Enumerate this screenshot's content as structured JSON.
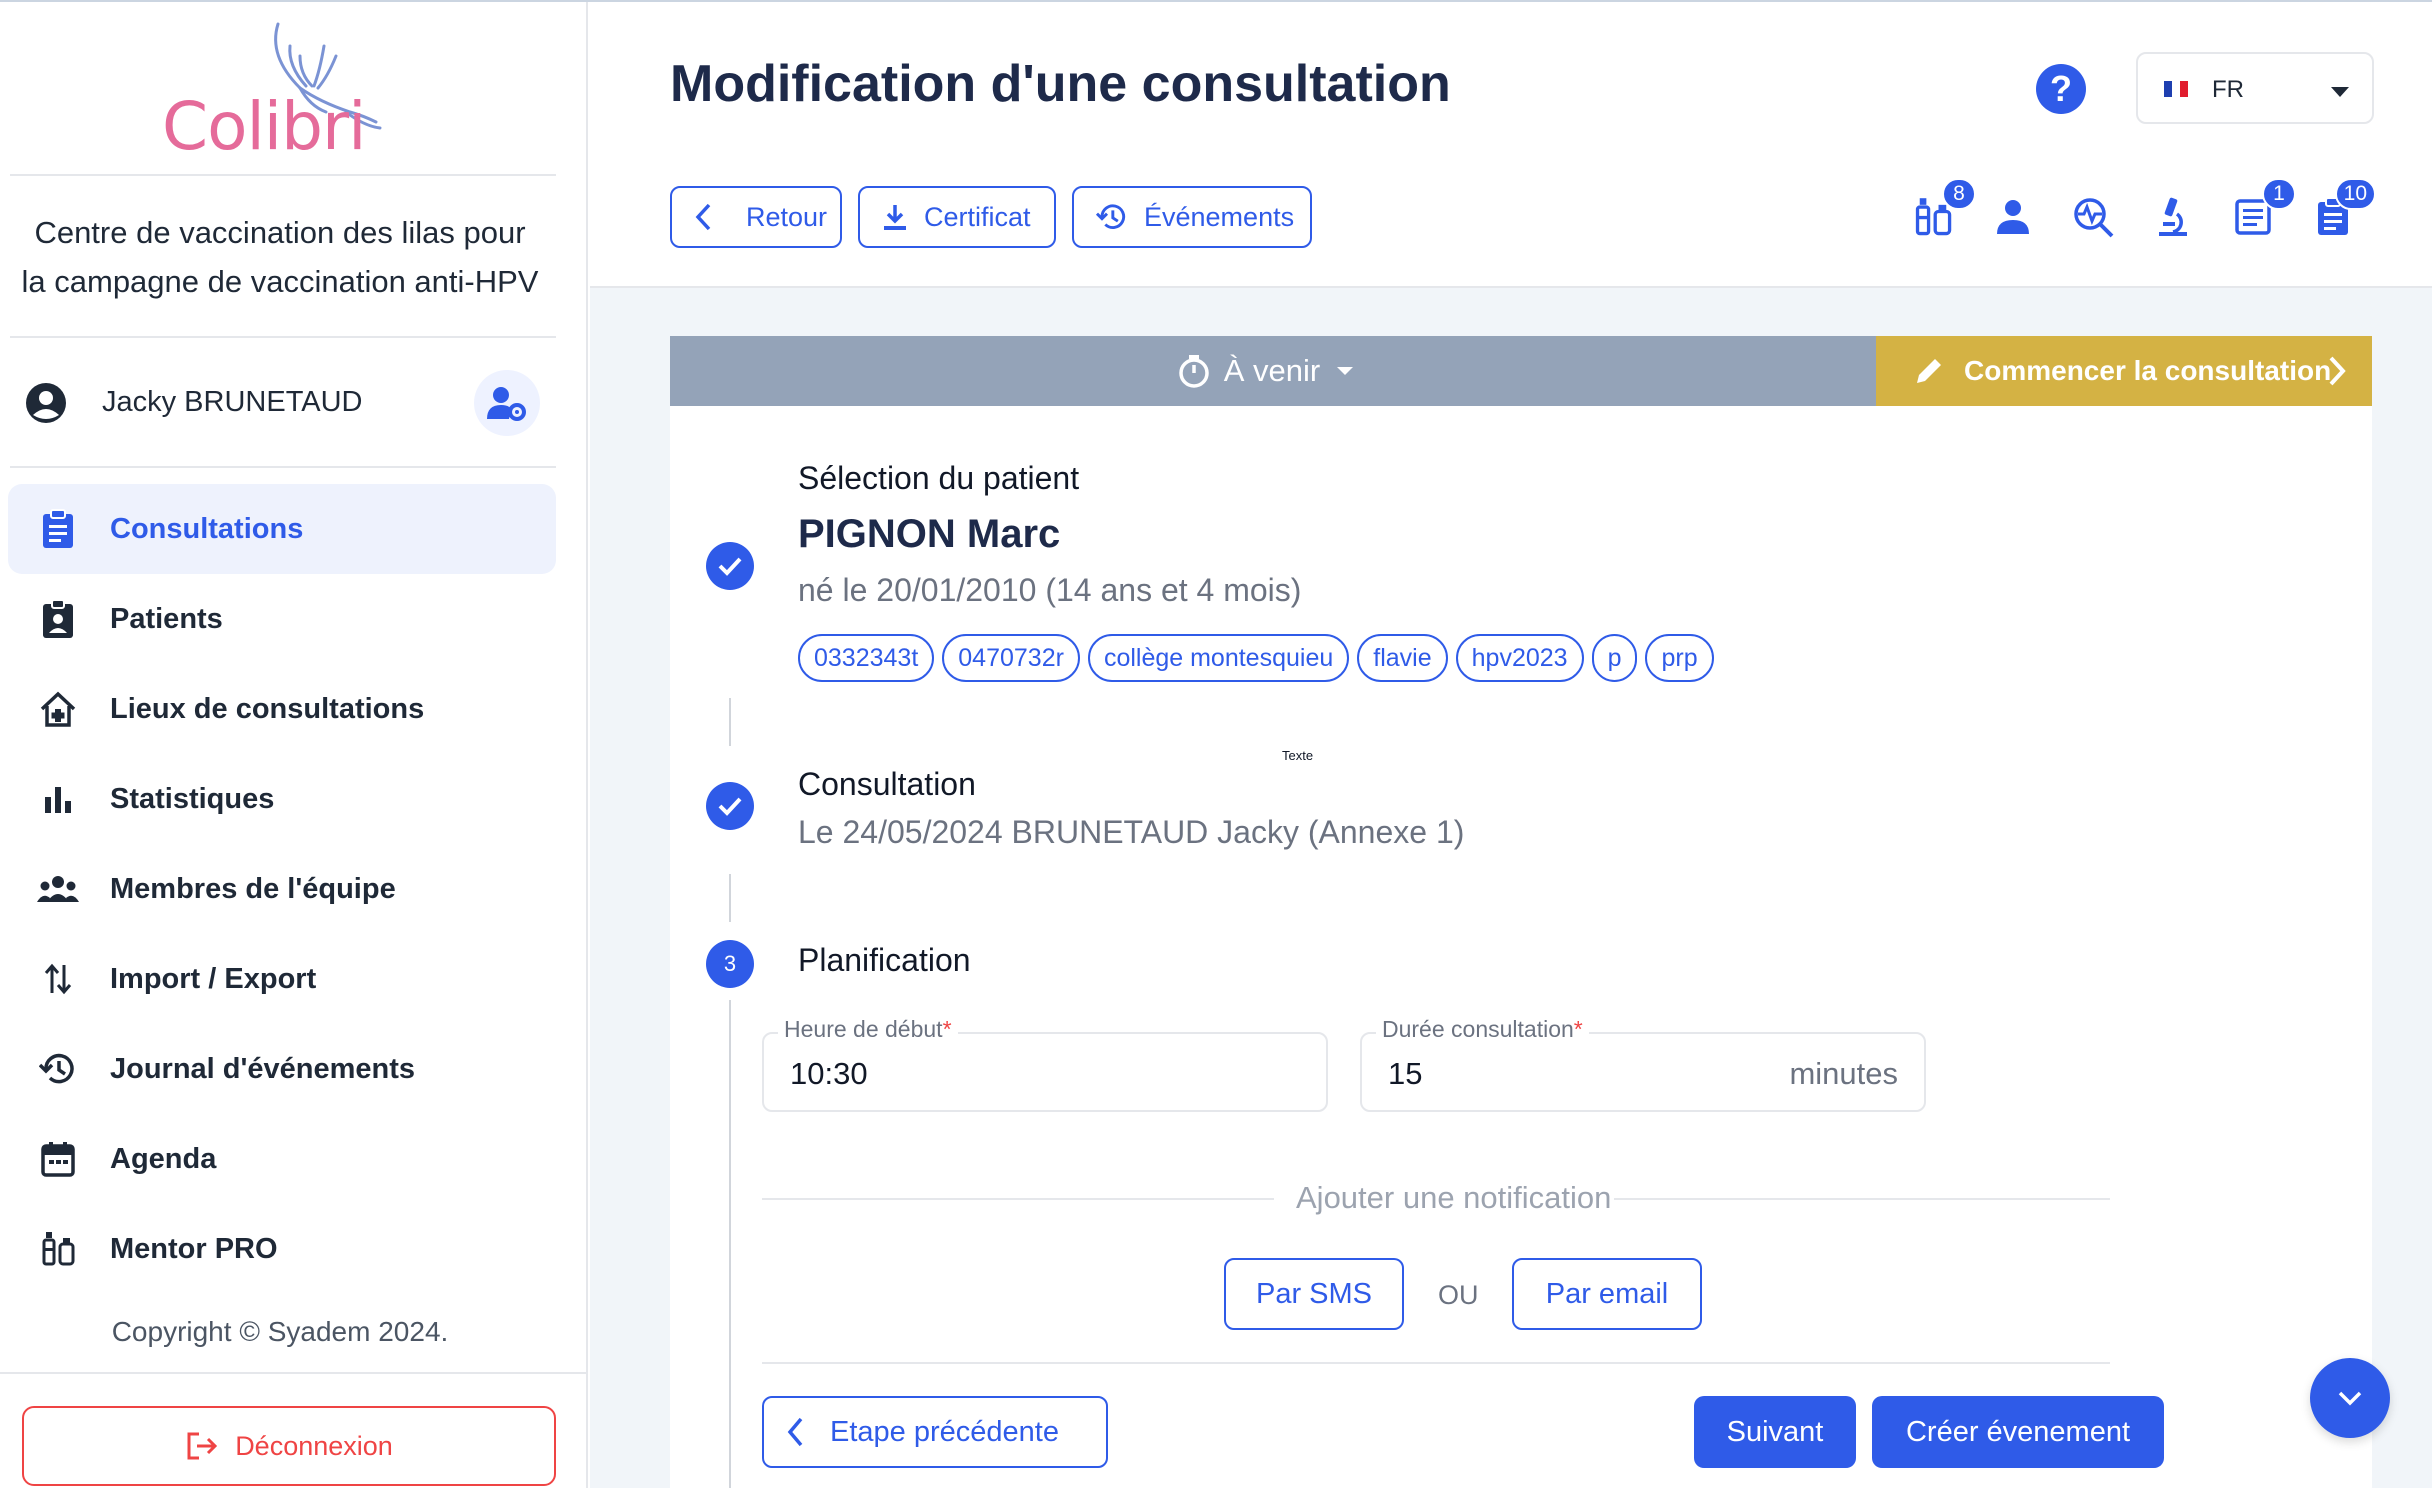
{
  "brand": {
    "logo_text": "Colibri"
  },
  "sidebar": {
    "center_line1": "Centre de vaccination des lilas pour",
    "center_line2": "la campagne de vaccination anti-HPV",
    "user_name": "Jacky BRUNETAUD",
    "items": [
      {
        "label": "Consultations",
        "icon": "clipboard-icon",
        "active": true
      },
      {
        "label": "Patients",
        "icon": "patient-badge-icon"
      },
      {
        "label": "Lieux de consultations",
        "icon": "home-medical-icon"
      },
      {
        "label": "Statistiques",
        "icon": "bar-chart-icon"
      },
      {
        "label": "Membres de l'équipe",
        "icon": "team-icon"
      },
      {
        "label": "Import / Export",
        "icon": "import-export-icon"
      },
      {
        "label": "Journal d'événements",
        "icon": "history-icon"
      },
      {
        "label": "Agenda",
        "icon": "calendar-icon"
      },
      {
        "label": "Mentor PRO",
        "icon": "vaccine-icon"
      }
    ],
    "copyright": "Copyright © Syadem 2024.",
    "logout_label": "Déconnexion"
  },
  "header": {
    "title": "Modification d'une consultation",
    "help_label": "?",
    "language": "FR",
    "buttons": {
      "back": "Retour",
      "certificate": "Certificat",
      "events": "Événements"
    },
    "tool_badges": {
      "vaccines": "8",
      "notes": "1",
      "documents": "10"
    }
  },
  "status": {
    "state_label": "À venir",
    "start_label": "Commencer la consultation"
  },
  "steps": {
    "patient": {
      "title": "Sélection du patient",
      "name": "PIGNON Marc",
      "birth": "né le 20/01/2010 (14 ans et 4 mois)",
      "tags": [
        "0332343t",
        "0470732r",
        "collège montesquieu",
        "flavie",
        "hpv2023",
        "p",
        "prp"
      ]
    },
    "consultation": {
      "title": "Consultation",
      "detail": "Le 24/05/2024 BRUNETAUD Jacky (Annexe 1)",
      "tiny_label": "Texte"
    },
    "planning": {
      "number": "3",
      "title": "Planification",
      "start_label": "Heure de début",
      "start_value": "10:30",
      "duration_label": "Durée consultation",
      "duration_value": "15",
      "duration_unit": "minutes",
      "required_mark": "*",
      "notification_title": "Ajouter une notification",
      "sms_label": "Par SMS",
      "or_label": "OU",
      "email_label": "Par email",
      "prev_label": "Etape précédente",
      "next_label": "Suivant",
      "create_event_label": "Créer évenement"
    }
  },
  "colors": {
    "accent": "#2f5be8",
    "status_grey": "#94a3b8",
    "start_gold": "#d4b244",
    "danger": "#ef4444",
    "brand_pink": "#e56b9a"
  }
}
